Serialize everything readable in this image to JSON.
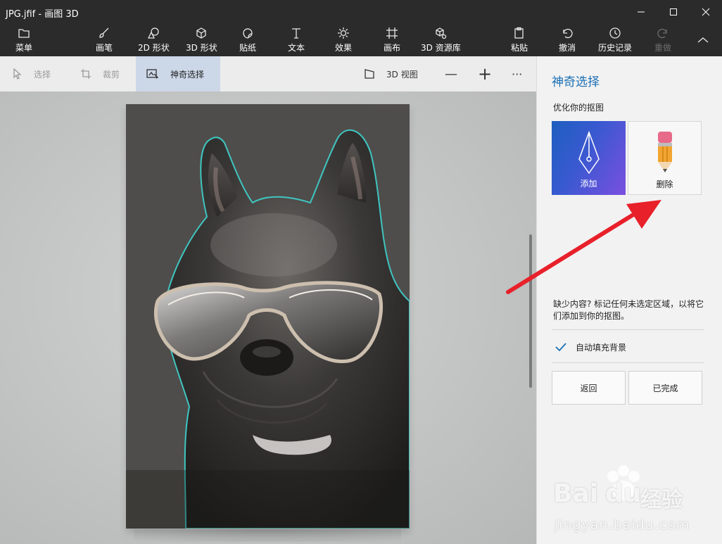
{
  "window": {
    "title": "JPG.jfif - 画图 3D"
  },
  "ribbon": {
    "menu": "菜单",
    "brush": "画笔",
    "shapes_2d": "2D 形状",
    "shapes_3d": "3D 形状",
    "stickers": "贴纸",
    "text": "文本",
    "effects": "效果",
    "canvas": "画布",
    "library_3d": "3D 资源库",
    "paste": "粘贴",
    "undo": "撤消",
    "history": "历史记录",
    "redo": "重做"
  },
  "toolbar": {
    "select": "选择",
    "crop": "裁剪",
    "magic_select": "神奇选择",
    "view_3d": "3D 视图",
    "zoom_out": "—",
    "zoom_in": "+",
    "more": "···"
  },
  "panel": {
    "title": "神奇选择",
    "subtitle": "优化你的抠图",
    "add": "添加",
    "remove": "删除",
    "hint": "缺少内容? 标记任何未选定区域，以将它们添加到你的抠图。",
    "autofill": "自动填充背景",
    "autofill_checked": true,
    "back": "返回",
    "done": "已完成"
  },
  "watermark": {
    "brand": "Bai",
    "brand2": "du",
    "label": "经验",
    "url": "jingyan.baidu.com"
  },
  "colors": {
    "accent": "#1a6fb5",
    "selection_outline": "#3fc5c0",
    "annotation_arrow": "#e8202a"
  }
}
